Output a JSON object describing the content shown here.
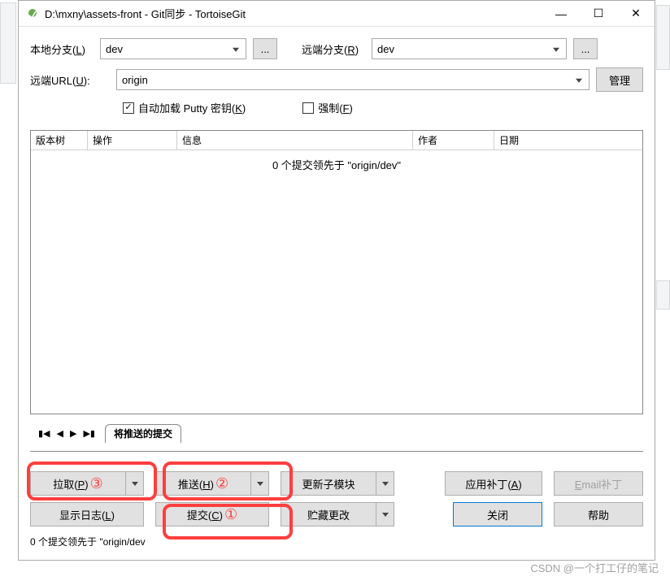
{
  "window": {
    "title": "D:\\mxny\\assets-front - Git同步 - TortoiseGit"
  },
  "form": {
    "local_branch_label": "本地分支(",
    "local_branch_key": "L",
    "local_branch_close": ")",
    "local_branch_value": "dev",
    "remote_branch_label": "远端分支(",
    "remote_branch_key": "R",
    "remote_branch_close": ")",
    "remote_branch_value": "dev",
    "dots": "...",
    "remote_url_label": "远端URL(",
    "remote_url_key": "U",
    "remote_url_close": "):",
    "remote_url_value": "origin",
    "manage_label": "管理",
    "auto_putty_label_pre": "自动加载 Putty 密钥(",
    "auto_putty_key": "K",
    "auto_putty_close": ")",
    "force_label_pre": "强制(",
    "force_key": "F",
    "force_close": ")"
  },
  "table": {
    "cols": {
      "tree": "版本树",
      "op": "操作",
      "info": "信息",
      "author": "作者",
      "date": "日期"
    },
    "message": "0 个提交领先于 \"origin/dev\""
  },
  "tabs": {
    "commits_to_push": "将推送的提交"
  },
  "buttons": {
    "pull_pre": "拉取(",
    "pull_key": "P",
    "pull_close": ")",
    "push_pre": "推送(",
    "push_key": "H",
    "push_close": ")",
    "submodule": "更新子模块",
    "apply_patch_pre": "应用补丁(",
    "apply_patch_key": "A",
    "apply_patch_close": ")",
    "email_patch_pre": "E",
    "email_patch_post": "mail补丁",
    "show_log_pre": "显示日志(",
    "show_log_key": "L",
    "show_log_close": ")",
    "commit_pre": "提交(",
    "commit_key": "C",
    "commit_close": ")",
    "stash": "贮藏更改",
    "close": "关闭",
    "help": "帮助",
    "num1": "①",
    "num2": "②",
    "num3": "③"
  },
  "status": "0 个提交领先于 \"origin/dev",
  "watermark": "CSDN @一个打工仔的笔记"
}
